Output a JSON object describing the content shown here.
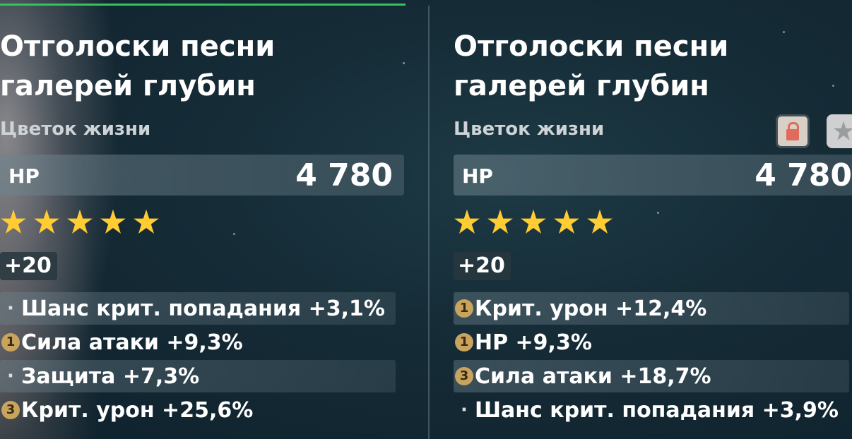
{
  "left_panel": {
    "title_line1": "Отголоски песни",
    "title_line2": "галерей глубин",
    "slot": "Цветок жизни",
    "main_stat": {
      "label": "HP",
      "value": "4 780"
    },
    "rarity_stars": 5,
    "level": "+20",
    "substats": [
      {
        "marker": "·",
        "text": "Шанс крит. попадания +3,1%"
      },
      {
        "marker": "1",
        "text": "Сила атаки +9,3%"
      },
      {
        "marker": "·",
        "text": "Защита +7,3%"
      },
      {
        "marker": "3",
        "text": "Крит. урон +25,6%"
      }
    ]
  },
  "right_panel": {
    "title_line1": "Отголоски песни",
    "title_line2": "галерей глубин",
    "slot": "Цветок жизни",
    "main_stat": {
      "label": "HP",
      "value": "4 780"
    },
    "rarity_stars": 5,
    "level": "+20",
    "lock_icon": "lock-icon",
    "favorite_icon": "star-icon",
    "substats": [
      {
        "marker": "1",
        "text": "Крит. урон +12,4%"
      },
      {
        "marker": "1",
        "text": "HP +9,3%"
      },
      {
        "marker": "3",
        "text": "Сила атаки +18,7%"
      },
      {
        "marker": "·",
        "text": "Шанс крит. попадания +3,9%"
      }
    ]
  },
  "colors": {
    "star": "#ffcc32",
    "upgrade_badge": "#c9a45f",
    "accent_line": "#35c45a",
    "lock": "#e06a5b"
  }
}
